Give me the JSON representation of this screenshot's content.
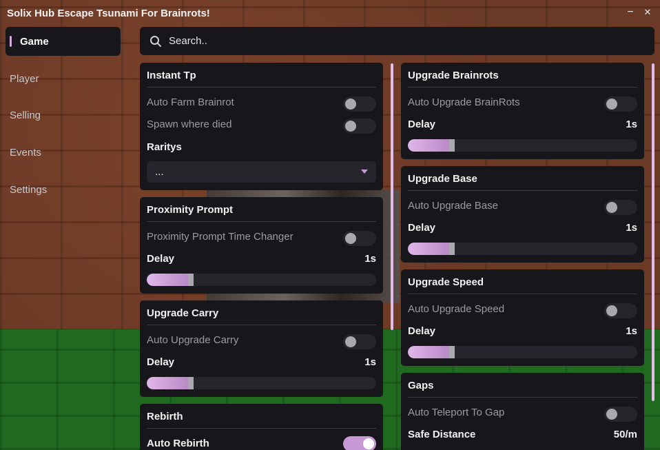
{
  "window": {
    "title": "Solix Hub Escape Tsunami For Brainrots!",
    "minimize_glyph": "−",
    "close_glyph": "✕"
  },
  "sidebar": {
    "items": [
      {
        "label": "Game",
        "active": true
      },
      {
        "label": "Player",
        "active": false
      },
      {
        "label": "Selling",
        "active": false
      },
      {
        "label": "Events",
        "active": false
      },
      {
        "label": "Settings",
        "active": false
      }
    ]
  },
  "search": {
    "placeholder": "Search..",
    "icon": "search-icon"
  },
  "colors": {
    "accent": "#d7a7e0",
    "panel": "#17161b",
    "control": "#26252b"
  },
  "left": {
    "instant_tp": {
      "title": "Instant Tp",
      "auto_farm_label": "Auto Farm Brainrot",
      "auto_farm_on": false,
      "spawn_label": "Spawn where died",
      "spawn_on": false,
      "raritys_label": "Raritys",
      "raritys_value": "..."
    },
    "proximity": {
      "title": "Proximity Prompt",
      "changer_label": "Proximity Prompt Time Changer",
      "changer_on": false,
      "delay_label": "Delay",
      "delay_value": "1s",
      "delay_fill": 0.18
    },
    "upgrade_carry": {
      "title": "Upgrade Carry",
      "auto_label": "Auto Upgrade Carry",
      "auto_on": false,
      "delay_label": "Delay",
      "delay_value": "1s",
      "delay_fill": 0.18
    },
    "rebirth": {
      "title": "Rebirth",
      "auto_label": "Auto Rebirth",
      "auto_on": true
    }
  },
  "right": {
    "upgrade_brainrots": {
      "title": "Upgrade Brainrots",
      "auto_label": "Auto Upgrade BrainRots",
      "auto_on": false,
      "delay_label": "Delay",
      "delay_value": "1s",
      "delay_fill": 0.18
    },
    "upgrade_base": {
      "title": "Upgrade Base",
      "auto_label": "Auto Upgrade Base",
      "auto_on": false,
      "delay_label": "Delay",
      "delay_value": "1s",
      "delay_fill": 0.18
    },
    "upgrade_speed": {
      "title": "Upgrade Speed",
      "auto_label": "Auto Upgrade Speed",
      "auto_on": false,
      "delay_label": "Delay",
      "delay_value": "1s",
      "delay_fill": 0.18
    },
    "gaps": {
      "title": "Gaps",
      "auto_label": "Auto Teleport To Gap",
      "auto_on": false,
      "safe_label": "Safe Distance",
      "safe_value": "50/m"
    }
  }
}
